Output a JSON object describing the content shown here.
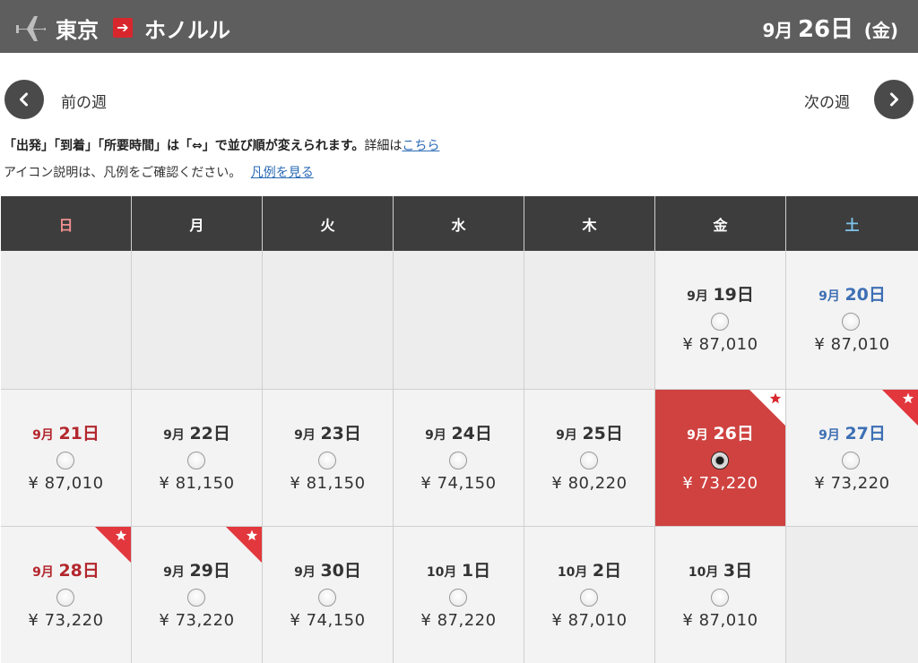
{
  "header": {
    "origin": "東京",
    "arrow_glyph": "➔",
    "destination": "ホノルル",
    "date_month": "9月",
    "date_day": "26日",
    "date_weekday": "(金)"
  },
  "nav": {
    "prev_label": "前の週",
    "next_label": "次の週"
  },
  "notes": {
    "sort_note_bold": "「出発」「到着」「所要時間」は「⇔」で並び順が変えられます。",
    "sort_note_detail": "詳細は",
    "sort_note_link": "こちら",
    "icon_note": "アイコン説明は、凡例をご確認ください。",
    "legend_link": "凡例を見る"
  },
  "calendar": {
    "weekdays": [
      "日",
      "月",
      "火",
      "水",
      "木",
      "金",
      "土"
    ],
    "selected_date": "9月 26日",
    "weeks": [
      [
        {
          "empty": true
        },
        {
          "empty": true
        },
        {
          "empty": true
        },
        {
          "empty": true
        },
        {
          "empty": true
        },
        {
          "month": "9月",
          "day": "19日",
          "price": "¥ 87,010"
        },
        {
          "month": "9月",
          "day": "20日",
          "price": "¥ 87,010"
        }
      ],
      [
        {
          "month": "9月",
          "day": "21日",
          "price": "¥ 87,010"
        },
        {
          "month": "9月",
          "day": "22日",
          "price": "¥ 81,150"
        },
        {
          "month": "9月",
          "day": "23日",
          "price": "¥ 81,150"
        },
        {
          "month": "9月",
          "day": "24日",
          "price": "¥ 74,150"
        },
        {
          "month": "9月",
          "day": "25日",
          "price": "¥ 80,220"
        },
        {
          "month": "9月",
          "day": "26日",
          "price": "¥ 73,220",
          "selected": true,
          "star": true
        },
        {
          "month": "9月",
          "day": "27日",
          "price": "¥ 73,220",
          "star": true
        }
      ],
      [
        {
          "month": "9月",
          "day": "28日",
          "price": "¥ 73,220",
          "star": true
        },
        {
          "month": "9月",
          "day": "29日",
          "price": "¥ 73,220",
          "star": true
        },
        {
          "month": "9月",
          "day": "30日",
          "price": "¥ 74,150"
        },
        {
          "month": "10月",
          "day": "1日",
          "price": "¥ 87,220"
        },
        {
          "month": "10月",
          "day": "2日",
          "price": "¥ 87,010"
        },
        {
          "month": "10月",
          "day": "3日",
          "price": "¥ 87,010"
        },
        {
          "empty": true
        }
      ]
    ]
  },
  "colors": {
    "header_bg": "#5e5e5e",
    "brand_red": "#d8262d",
    "selected_cell": "#cf4240",
    "sunday": "#b3272d",
    "saturday": "#3d6fb4",
    "link": "#2a6bb5"
  },
  "icons": {
    "plane": "plane-icon",
    "prev": "chevron-left-icon",
    "next": "chevron-right-icon",
    "star": "star-ribbon-icon"
  }
}
